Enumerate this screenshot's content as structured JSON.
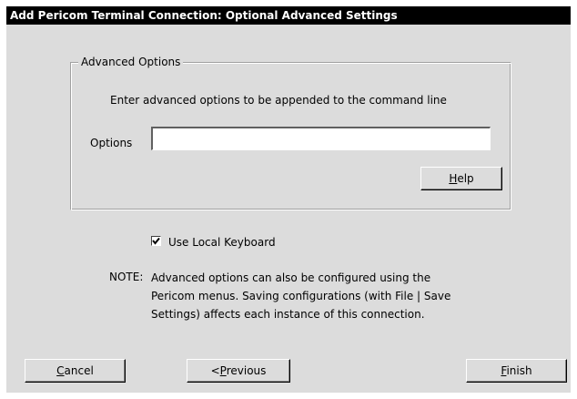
{
  "window": {
    "title": "Add Pericom Terminal Connection: Optional Advanced Settings"
  },
  "advanced": {
    "group_title": "Advanced Options",
    "description": "Enter advanced options to be appended to the command line",
    "options_label": "Options",
    "options_value": "",
    "help_prefix": "",
    "help_mnemonic": "H",
    "help_rest": "elp"
  },
  "keyboard": {
    "label": "Use Local Keyboard",
    "checked": true,
    "icon": "checkmark-icon"
  },
  "note": {
    "label": "NOTE:",
    "lines": [
      "Advanced options can also be configured using the",
      "Pericom menus.  Saving configurations (with File | Save",
      "Settings) affects each instance of this connection."
    ]
  },
  "buttons": {
    "cancel": {
      "prefix": "",
      "mnemonic": "C",
      "rest": "ancel"
    },
    "previous": {
      "prefix": "<",
      "mnemonic": "P",
      "rest": "revious"
    },
    "finish": {
      "prefix": "",
      "mnemonic": "F",
      "rest": "inish"
    }
  },
  "colors": {
    "dialog_bg": "#dcdcdc",
    "titlebar_bg": "#000000",
    "titlebar_fg": "#ffffff"
  }
}
